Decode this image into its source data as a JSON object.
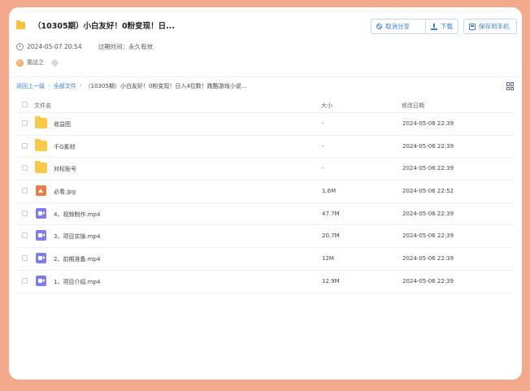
{
  "share": {
    "title": "（10305期）小白友好！0粉变现！日...",
    "date": "2024-05-07 20:54",
    "expiry": "过期时间：永久有效",
    "user_name": "蘭話之"
  },
  "actions": {
    "cancel_label": "取消分享",
    "download_label": "下载",
    "save_label": "保存到手机"
  },
  "breadcrumb": {
    "back": "返回上一级",
    "all_files": "全部文件",
    "sep": "›",
    "current": "（10305期）小白友好！0粉变现！日入4位数！跑酷游戏小说..."
  },
  "table": {
    "headers": {
      "name": "文件名",
      "size": "大小",
      "date": "修改日期"
    },
    "rows": [
      {
        "icon": "folder-icon",
        "name": "收益图",
        "size": "-",
        "date": "2024-05-06 22:39"
      },
      {
        "icon": "folder-icon",
        "name": "千G素材",
        "size": "-",
        "date": "2024-05-06 22:39"
      },
      {
        "icon": "folder-icon",
        "name": "对标账号",
        "size": "-",
        "date": "2024-05-06 22:39"
      },
      {
        "icon": "image-file-icon",
        "name": "必看.jpg",
        "size": "1.6M",
        "date": "2024-05-06 22:52"
      },
      {
        "icon": "video-file-icon",
        "name": "4、视频制作.mp4",
        "size": "47.7M",
        "date": "2024-05-06 22:39"
      },
      {
        "icon": "video-file-icon",
        "name": "3、项目实操.mp4",
        "size": "20.7M",
        "date": "2024-05-06 22:39"
      },
      {
        "icon": "video-file-icon",
        "name": "2、前期准备.mp4",
        "size": "12M",
        "date": "2024-05-06 22:39"
      },
      {
        "icon": "video-file-icon",
        "name": "1、项目介绍.mp4",
        "size": "12.9M",
        "date": "2024-05-06 22:39"
      }
    ]
  },
  "colors": {
    "background": "#f2a98c",
    "accent": "#3b7fd8",
    "folder": "#f8c94b",
    "image": "#ee7c4b",
    "video": "#7f7cf0"
  }
}
